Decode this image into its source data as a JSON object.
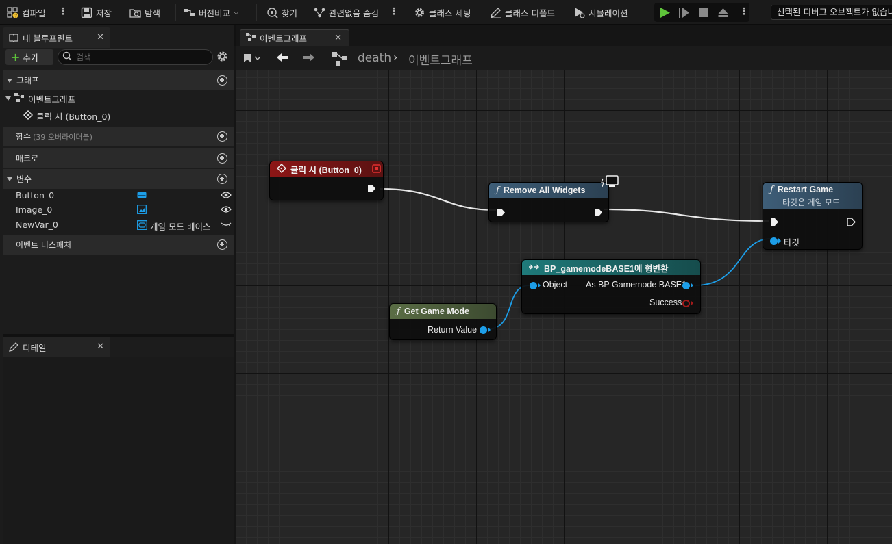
{
  "toolbar": {
    "compile": "컴파일",
    "save": "저장",
    "browse": "탐색",
    "diff": "버전비교",
    "find": "찾기",
    "hide_unrelated": "관련없음 숨김",
    "class_settings": "클래스 세팅",
    "class_defaults": "클래스 디폴트",
    "simulation": "시뮬레이션",
    "debug_object": "선택된 디버그 오브젝트가 없습니다"
  },
  "blueprint_panel": {
    "title": "내 블루프린트",
    "add_label": "추가",
    "search_placeholder": "검색",
    "graphs_section": "그래프",
    "event_graph": "이벤트그래프",
    "event_item": "클릭 시 (Button_0)",
    "functions_section": "함수",
    "functions_override": "(39 오버라이더블)",
    "macros_section": "매크로",
    "variables_section": "변수",
    "variables": [
      {
        "name": "Button_0",
        "type_label": "",
        "icon": "widget-button-icon",
        "visibility": "eye-open"
      },
      {
        "name": "Image_0",
        "type_label": "",
        "icon": "widget-image-icon",
        "visibility": "eye-open"
      },
      {
        "name": "NewVar_0",
        "type_label": "게임 모드 베이스",
        "icon": "gamemode-icon",
        "visibility": "eye-closed"
      }
    ],
    "dispatchers_section": "이벤트 디스패처"
  },
  "details_panel": {
    "title": "디테일"
  },
  "graph_tab": {
    "label": "이벤트그래프"
  },
  "breadcrumb": {
    "blueprint": "death",
    "graph": "이벤트그래프"
  },
  "nodes": {
    "on_clicked": {
      "title": "클릭 시 (Button_0)"
    },
    "remove_widgets": {
      "title": "Remove All Widgets"
    },
    "restart_game": {
      "title": "Restart Game",
      "subtitle": "타깃은 게임 모드",
      "target_pin": "타깃"
    },
    "cast": {
      "title": "BP_gamemodeBASE1에 형변환",
      "object_pin": "Object",
      "as_pin": "As BP Gamemode BASE1",
      "success_pin": "Success"
    },
    "get_game_mode": {
      "title": "Get Game Mode",
      "return_pin": "Return Value"
    }
  },
  "colors": {
    "event_header": "#7c1414",
    "function_header": "#3e5e78",
    "pure_header": "#53663f",
    "cast_header": "#1c6e6e",
    "data_pin": "#1d9ee8",
    "accent_green": "#5ec43a"
  }
}
